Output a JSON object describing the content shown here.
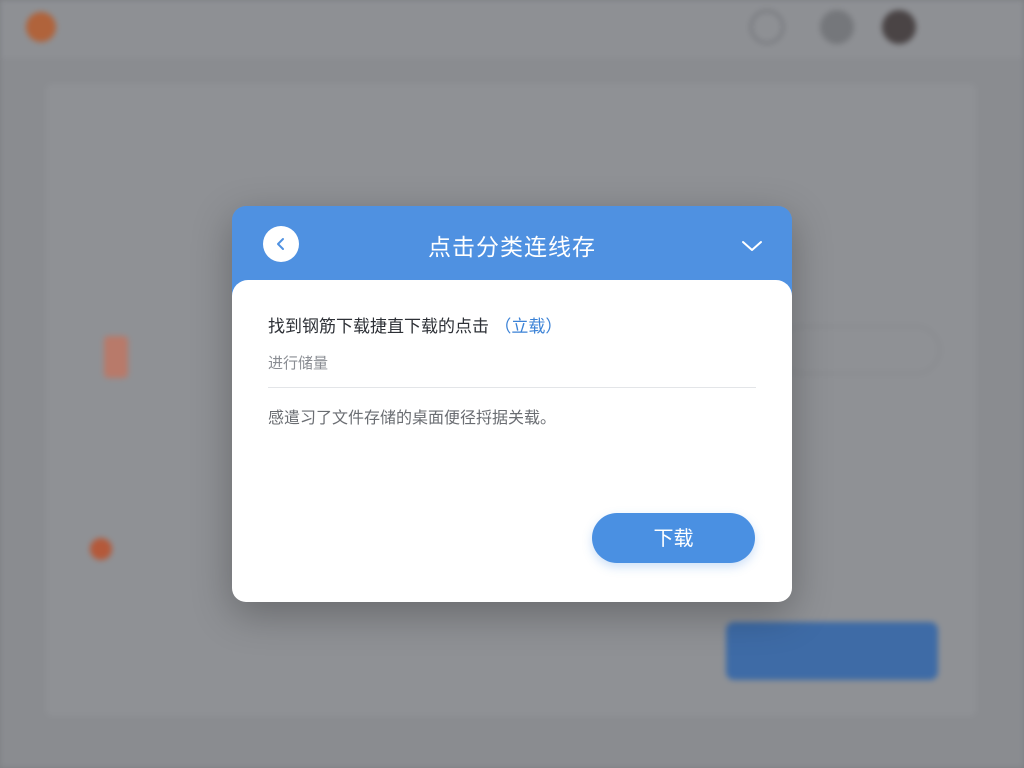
{
  "modal": {
    "title": "点击分类连线存",
    "message_prefix": "找到钢筋下载捷直下载的点击",
    "message_link": "（立载）",
    "subtitle": "进行储量",
    "description": "感遣习了文件存储的桌面便径捋据关载。",
    "download_label": "下载",
    "back_icon": "chevron-left-icon",
    "collapse_icon": "chevron-down-icon",
    "colors": {
      "header": "#4f91e1",
      "button": "#4a90e2",
      "link": "#3b82d6"
    }
  }
}
